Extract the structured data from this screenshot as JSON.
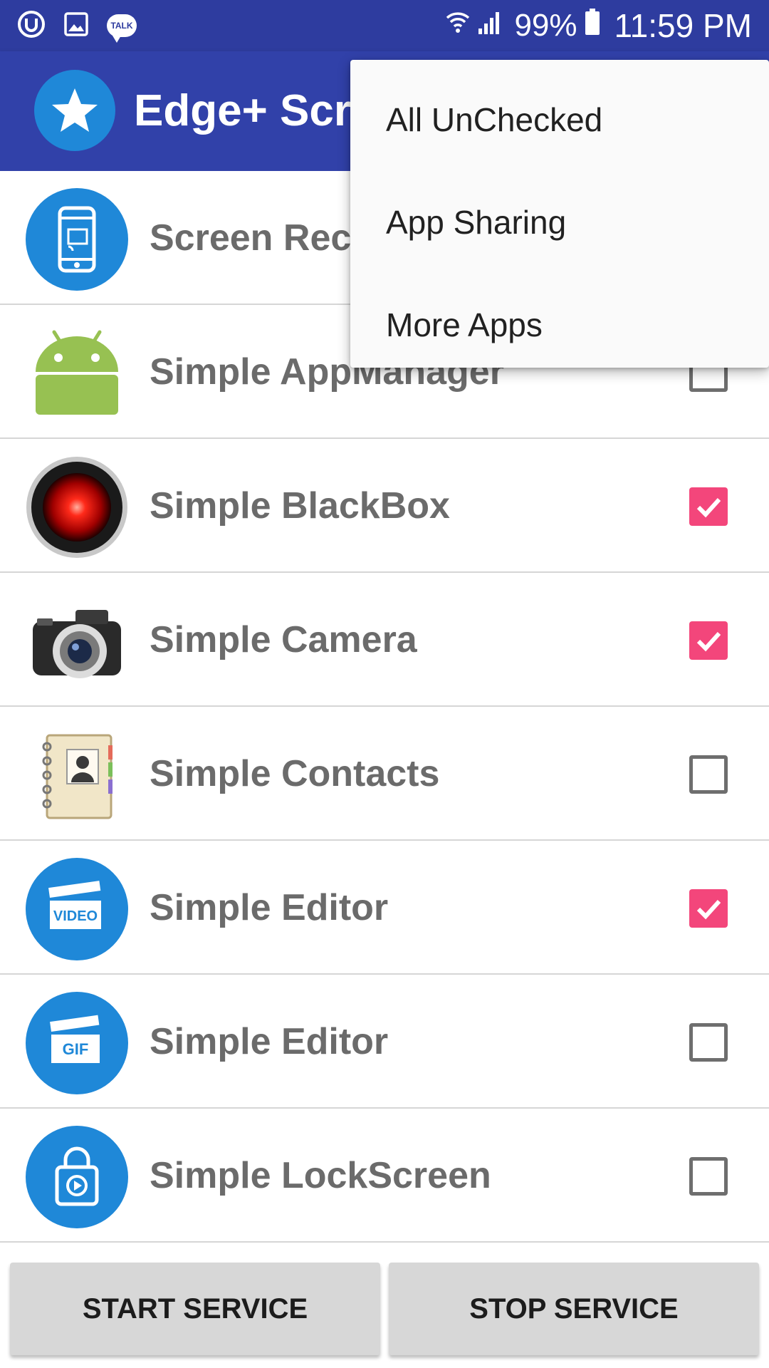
{
  "status_bar": {
    "icons_left": [
      "u-plus-icon",
      "gallery-icon",
      "talk-icon"
    ],
    "talk_label": "TALK",
    "battery_percent": "99%",
    "time": "11:59 PM"
  },
  "app_bar": {
    "title": "Edge+ Screen Recorder",
    "logo_icon": "star-icon"
  },
  "items": [
    {
      "label": "Screen Recorder",
      "icon": "screen-cast-phone-icon",
      "checked": null
    },
    {
      "label": "Simple AppManager",
      "icon": "android-icon",
      "checked": false
    },
    {
      "label": "Simple BlackBox",
      "icon": "red-lens-icon",
      "checked": true
    },
    {
      "label": "Simple Camera",
      "icon": "camera-icon",
      "checked": true
    },
    {
      "label": "Simple Contacts",
      "icon": "contacts-book-icon",
      "checked": false
    },
    {
      "label": "Simple Editor",
      "icon": "video-clapper-icon",
      "icon_text": "VIDEO",
      "checked": true
    },
    {
      "label": "Simple Editor",
      "icon": "gif-clapper-icon",
      "icon_text": "GIF",
      "checked": false
    },
    {
      "label": "Simple LockScreen",
      "icon": "lock-play-icon",
      "checked": false
    }
  ],
  "buttons": {
    "start": "START SERVICE",
    "stop": "STOP SERVICE"
  },
  "menu": {
    "items": [
      "All UnChecked",
      "App Sharing",
      "More Apps"
    ]
  },
  "colors": {
    "status_bar": "#2e3c9f",
    "app_bar": "#3141a9",
    "checkbox_checked": "#f3467b",
    "icon_blue": "#1f88d8"
  }
}
